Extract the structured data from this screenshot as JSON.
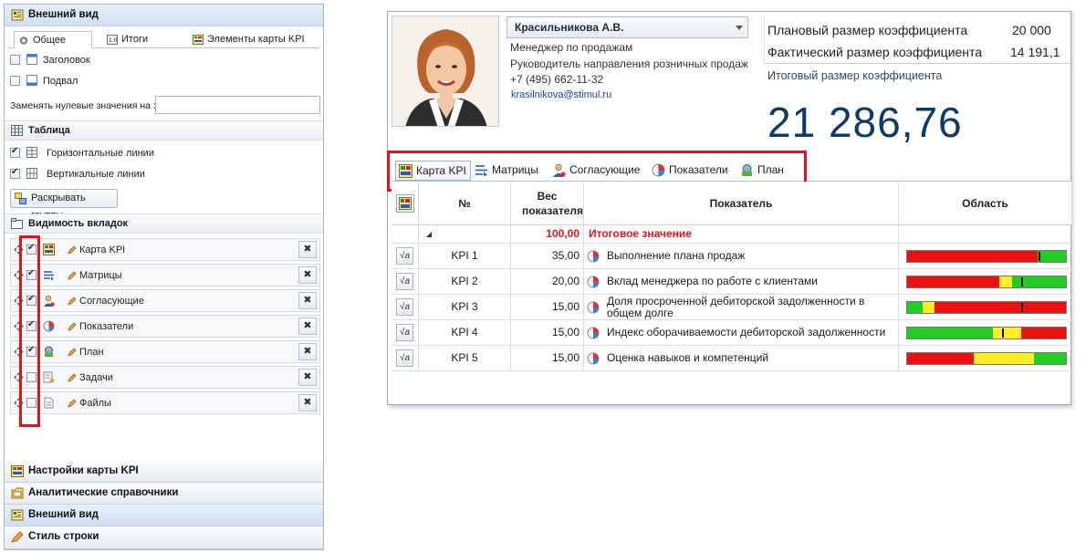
{
  "left_panel": {
    "header_appearance": "Внешний вид",
    "tabs": [
      {
        "label": "Общее",
        "icon": "gear-icon",
        "active": true
      },
      {
        "label": "Итоги",
        "icon": "sum-icon",
        "active": false
      },
      {
        "label": "Элементы карты KPI",
        "icon": "kpi-map-icon",
        "active": false
      }
    ],
    "general": {
      "header_label": "Заголовок",
      "header_checked": false,
      "footer_label": "Подвал",
      "footer_checked": false,
      "zero_replace_label": "Заменять нулевые значения на :",
      "zero_replace_value": ""
    },
    "table_section": {
      "title": "Таблица",
      "horizontal_lines": "Горизонтальные линии",
      "horizontal_checked": true,
      "vertical_lines": "Вертикальные линии",
      "vertical_checked": true,
      "expand_groups_button": "Раскрывать группы"
    },
    "tab_visibility": {
      "title": "Видимость вкладок",
      "items": [
        {
          "label": "Карта KPI",
          "checked": true,
          "icon": "kpi-map-icon"
        },
        {
          "label": "Матрицы",
          "checked": true,
          "icon": "matrix-icon"
        },
        {
          "label": "Согласующие",
          "checked": true,
          "icon": "approvers-icon"
        },
        {
          "label": "Показатели",
          "checked": true,
          "icon": "indicators-icon"
        },
        {
          "label": "План",
          "checked": true,
          "icon": "plan-icon"
        },
        {
          "label": "Задачи",
          "checked": false,
          "icon": "tasks-icon"
        },
        {
          "label": "Файлы",
          "checked": false,
          "icon": "files-icon"
        }
      ],
      "delete_glyph": "✖"
    },
    "bottom_sections": [
      {
        "label": "Настройки карты KPI",
        "active": false
      },
      {
        "label": "Аналитические справочники",
        "active": false
      },
      {
        "label": "Внешний вид",
        "active": true
      },
      {
        "label": "Стиль строки",
        "active": false
      }
    ]
  },
  "right_panel": {
    "employee": {
      "name": "Красильникова А.В.",
      "position": "Менеджер по продажам",
      "role": "Руководитель направления розничных продаж",
      "phone": "+7 (495) 662-11-32",
      "email": "krasilnikova@stimul.ru"
    },
    "coefficients": {
      "planned_label": "Плановый размер коэффициента",
      "planned_value": "20 000",
      "actual_label": "Фактический размер коэффициента",
      "actual_value": "14 191,1",
      "total_label": "Итоговый размер коэффициента",
      "total_value": "21 286,76"
    },
    "tabs": [
      {
        "label": "Карта KPI",
        "icon": "kpi-map-icon",
        "active": true
      },
      {
        "label": "Матрицы",
        "icon": "matrix-icon",
        "active": false
      },
      {
        "label": "Согласующие",
        "icon": "approvers-icon",
        "active": false
      },
      {
        "label": "Показатели",
        "icon": "indicators-icon",
        "active": false
      },
      {
        "label": "План",
        "icon": "plan-icon",
        "active": false
      }
    ],
    "grid": {
      "columns": {
        "no": "№",
        "weight": "Вес показателя",
        "indicator": "Показатель",
        "area": "Область"
      },
      "total_row": {
        "weight": "100,00",
        "label": "Итоговое значение"
      },
      "sqrt_glyph": "√a",
      "rows": [
        {
          "no": "KPI 1",
          "weight": "35,00",
          "indicator": "Выполнение плана продаж",
          "gauge": [
            {
              "c": "#ee1111",
              "w": 0.82
            },
            {
              "c": "#22cc22",
              "w": 0.18
            }
          ],
          "marker": 0.83
        },
        {
          "no": "KPI 2",
          "weight": "20,00",
          "indicator": "Вклад менеджера по работе с клиентами",
          "gauge": [
            {
              "c": "#ee1111",
              "w": 0.58
            },
            {
              "c": "#ffee22",
              "w": 0.08
            },
            {
              "c": "#22cc22",
              "w": 0.34
            }
          ],
          "marker": 0.72
        },
        {
          "no": "KPI 3",
          "weight": "15,00",
          "indicator": "Доля просроченной дебиторской задолженности в общем долге",
          "gauge": [
            {
              "c": "#22cc22",
              "w": 0.1
            },
            {
              "c": "#ffee22",
              "w": 0.07
            },
            {
              "c": "#ee1111",
              "w": 0.83
            }
          ],
          "marker": 0.72
        },
        {
          "no": "KPI 4",
          "weight": "15,00",
          "indicator": "Индекс оборачиваемости дебиторской задолженности",
          "gauge": [
            {
              "c": "#22cc22",
              "w": 0.54
            },
            {
              "c": "#ffee22",
              "w": 0.18
            },
            {
              "c": "#ee1111",
              "w": 0.28
            }
          ],
          "marker": 0.6
        },
        {
          "no": "KPI 5",
          "weight": "15,00",
          "indicator": "Оценка навыков и компетенций",
          "gauge": [
            {
              "c": "#ee1111",
              "w": 0.42
            },
            {
              "c": "#ffee22",
              "w": 0.38
            },
            {
              "c": "#22cc22",
              "w": 0.2
            }
          ],
          "marker": null
        }
      ]
    }
  }
}
